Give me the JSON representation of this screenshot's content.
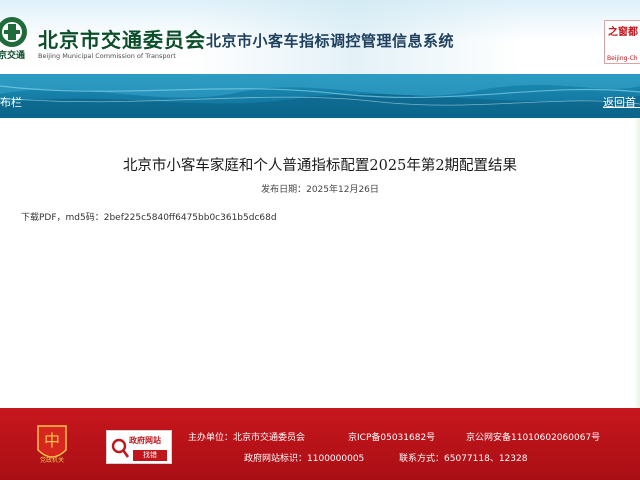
{
  "header": {
    "logo_icon_text": "京交通",
    "logo_cn": "北京市交通委员会",
    "logo_en": "Beijing Municipal Commission of Transport",
    "system_title": "北京市小客车指标调控管理信息系统",
    "badge_top": "之窗都",
    "badge_bottom": "Beijing-Ch"
  },
  "nav": {
    "left_label": "布栏",
    "right_label": "返回首"
  },
  "article": {
    "title": "北京市小客车家庭和个人普通指标配置2025年第2期配置结果",
    "date_label": "发布日期：",
    "date_value": "2025年12月26日",
    "body": "下载PDF，md5码：2bef225c5840ff6475bb0c361b5dc68d"
  },
  "footer": {
    "party_badge_text": "党政机关",
    "gov_badge_title": "政府网站",
    "gov_badge_button": "找错",
    "sponsor_label": "主办单位：",
    "sponsor_value": "北京市交通委员会",
    "icp": "京ICP备05031682号",
    "public_security": "京公网安备11010602060067号",
    "site_id_label": "政府网站标识：",
    "site_id_value": "1100000005",
    "contact_label": "联系方式：",
    "contact_value": "65077118、12328"
  },
  "colors": {
    "nav_blue": "#1580aa",
    "footer_red": "#b8121a",
    "logo_green": "#0b4e2a"
  }
}
